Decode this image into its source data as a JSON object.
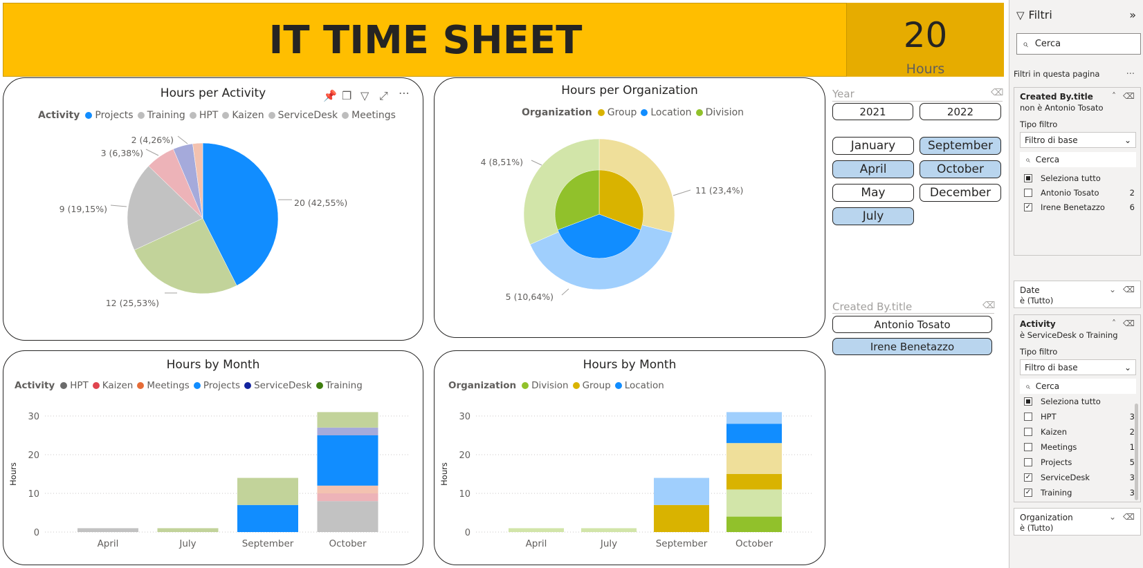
{
  "header": {
    "title": "IT TIME SHEET",
    "kpi_value": "20",
    "kpi_label": "Hours",
    "banner_color": "#FFBE00",
    "kpi_color": "#E6AC00"
  },
  "toolbar_icons": [
    "pin-icon",
    "copy-icon",
    "filter-icon",
    "focus-mode-icon",
    "more-options-icon"
  ],
  "charts": {
    "activity_pie": {
      "title": "Hours per Activity",
      "legend_title": "Activity",
      "legend": [
        {
          "name": "Projects",
          "color": "#118DFF"
        },
        {
          "name": "Training",
          "color": "#BDBDBD"
        },
        {
          "name": "HPT",
          "color": "#BDBDBD"
        },
        {
          "name": "Kaizen",
          "color": "#BDBDBD"
        },
        {
          "name": "ServiceDesk",
          "color": "#BDBDBD"
        },
        {
          "name": "Meetings",
          "color": "#BDBDBD"
        }
      ],
      "labels": [
        "20 (42,55%)",
        "12 (25,53%)",
        "9 (19,15%)",
        "3 (6,38%)",
        "2 (4,26%)"
      ]
    },
    "org_pie": {
      "title": "Hours per Organization",
      "legend_title": "Organization",
      "legend": [
        {
          "name": "Group",
          "color": "#D9B300"
        },
        {
          "name": "Location",
          "color": "#118DFF"
        },
        {
          "name": "Division",
          "color": "#91C12B"
        }
      ],
      "labels": [
        "11 (23,4%)",
        "5 (10,64%)",
        "4 (8,51%)"
      ]
    },
    "activity_month": {
      "title": "Hours by Month",
      "legend_title": "Activity",
      "legend": [
        {
          "name": "HPT",
          "color": "#6B6B6B"
        },
        {
          "name": "Kaizen",
          "color": "#E0444E"
        },
        {
          "name": "Meetings",
          "color": "#E66C37"
        },
        {
          "name": "Projects",
          "color": "#118DFF"
        },
        {
          "name": "ServiceDesk",
          "color": "#12239E"
        },
        {
          "name": "Training",
          "color": "#3E7D0E"
        }
      ],
      "ylabel": "Hours",
      "yticks": [
        "30",
        "20",
        "10",
        "0"
      ],
      "xticks": [
        "April",
        "July",
        "September",
        "October"
      ]
    },
    "org_month": {
      "title": "Hours by Month",
      "legend_title": "Organization",
      "legend": [
        {
          "name": "Division",
          "color": "#91C12B"
        },
        {
          "name": "Group",
          "color": "#D9B300"
        },
        {
          "name": "Location",
          "color": "#118DFF"
        }
      ],
      "ylabel": "Hours",
      "yticks": [
        "30",
        "20",
        "10",
        "0"
      ],
      "xticks": [
        "April",
        "July",
        "September",
        "October"
      ]
    }
  },
  "chart_data": [
    {
      "type": "pie",
      "title": "Hours per Activity",
      "labels": [
        "Projects",
        "Training",
        "HPT",
        "Kaizen",
        "ServiceDesk",
        "Meetings"
      ],
      "values": [
        20,
        12,
        9,
        3,
        2,
        1
      ],
      "colors": [
        "#118DFF",
        "#C2D39A",
        "#C2C2C2",
        "#EDB3B8",
        "#A5AADB",
        "#F3C2B0"
      ]
    },
    {
      "type": "pie",
      "title": "Hours per Organization",
      "rings": [
        {
          "ring": "outer",
          "values": [
            {
              "name": "Group",
              "value": 11,
              "color": "#EFDF9A"
            },
            {
              "name": "Location",
              "value": 15,
              "color": "#A0CFFD"
            },
            {
              "name": "Division",
              "value": 12,
              "color": "#D2E5A9"
            }
          ]
        },
        {
          "ring": "inner",
          "values": [
            {
              "name": "Group",
              "value": 4,
              "color": "#D9B300"
            },
            {
              "name": "Location",
              "value": 5,
              "color": "#118DFF"
            },
            {
              "name": "Division",
              "value": 4,
              "color": "#91C12B"
            }
          ]
        }
      ]
    },
    {
      "type": "bar",
      "stacked": true,
      "title": "Hours by Month",
      "categories": [
        "April",
        "July",
        "September",
        "October"
      ],
      "ylim": [
        0,
        32
      ],
      "ylabel": "Hours",
      "series": [
        {
          "name": "HPT",
          "values": [
            1,
            0,
            0,
            8
          ],
          "color": "#C2C2C2"
        },
        {
          "name": "Kaizen",
          "values": [
            0,
            0,
            0,
            2
          ],
          "color": "#EDB3B8"
        },
        {
          "name": "Meetings",
          "values": [
            0,
            0,
            0,
            2
          ],
          "color": "#F3C2B0"
        },
        {
          "name": "Projects",
          "values": [
            0,
            0,
            7,
            13
          ],
          "color": "#118DFF"
        },
        {
          "name": "ServiceDesk",
          "values": [
            0,
            0,
            0,
            2
          ],
          "color": "#A5AADB"
        },
        {
          "name": "Training",
          "values": [
            0,
            1,
            7,
            4
          ],
          "color": "#C2D39A"
        }
      ]
    },
    {
      "type": "bar",
      "stacked": true,
      "title": "Hours by Month",
      "categories": [
        "April",
        "July",
        "September",
        "October"
      ],
      "ylim": [
        0,
        32
      ],
      "ylabel": "Hours",
      "series": [
        {
          "name": "Division",
          "values": [
            0,
            0,
            0,
            4
          ],
          "color": "#91C12B"
        },
        {
          "name": "Division (light)",
          "values": [
            1,
            1,
            0,
            7
          ],
          "color": "#D2E5A9"
        },
        {
          "name": "Group",
          "values": [
            0,
            0,
            7,
            4
          ],
          "color": "#D9B300"
        },
        {
          "name": "Group (light)",
          "values": [
            0,
            0,
            0,
            8
          ],
          "color": "#EFDF9A"
        },
        {
          "name": "Location",
          "values": [
            0,
            0,
            0,
            5
          ],
          "color": "#118DFF"
        },
        {
          "name": "Location (light)",
          "values": [
            0,
            0,
            7,
            3
          ],
          "color": "#A0CFFD"
        }
      ]
    }
  ],
  "slicers": {
    "year": {
      "label": "Year",
      "options": [
        {
          "label": "2021",
          "selected": false
        },
        {
          "label": "2022",
          "selected": false
        }
      ]
    },
    "month": {
      "options": [
        {
          "label": "January",
          "selected": false
        },
        {
          "label": "September",
          "selected": true
        },
        {
          "label": "April",
          "selected": true
        },
        {
          "label": "October",
          "selected": true
        },
        {
          "label": "May",
          "selected": false
        },
        {
          "label": "December",
          "selected": false
        },
        {
          "label": "July",
          "selected": true
        }
      ]
    },
    "created_by": {
      "label": "Created By.title",
      "options": [
        {
          "label": "Antonio Tosato",
          "selected": false
        },
        {
          "label": "Irene Benetazzo",
          "selected": true
        }
      ]
    }
  },
  "filters_pane": {
    "title": "Filtri",
    "search_placeholder": "Cerca",
    "section_label": "Filtri in questa pagina",
    "more": "...",
    "created_by": {
      "title": "Created By.title",
      "desc": "non è Antonio Tosato",
      "type_label": "Tipo filtro",
      "type_value": "Filtro di base",
      "search": "Cerca",
      "select_all": "Seleziona tutto",
      "items": [
        {
          "label": "Antonio Tosato",
          "count": "2",
          "checked": false
        },
        {
          "label": "Irene Benetazzo",
          "count": "6",
          "checked": true
        }
      ]
    },
    "date": {
      "title": "Date",
      "desc": "è (Tutto)"
    },
    "activity": {
      "title": "Activity",
      "desc": "è ServiceDesk o Training",
      "type_label": "Tipo filtro",
      "type_value": "Filtro di base",
      "search": "Cerca",
      "select_all": "Seleziona tutto",
      "items": [
        {
          "label": "HPT",
          "count": "3",
          "checked": false
        },
        {
          "label": "Kaizen",
          "count": "2",
          "checked": false
        },
        {
          "label": "Meetings",
          "count": "1",
          "checked": false
        },
        {
          "label": "Projects",
          "count": "5",
          "checked": false
        },
        {
          "label": "ServiceDesk",
          "count": "3",
          "checked": true
        },
        {
          "label": "Training",
          "count": "3",
          "checked": true
        }
      ]
    },
    "organization": {
      "title": "Organization",
      "desc": "è (Tutto)"
    }
  }
}
